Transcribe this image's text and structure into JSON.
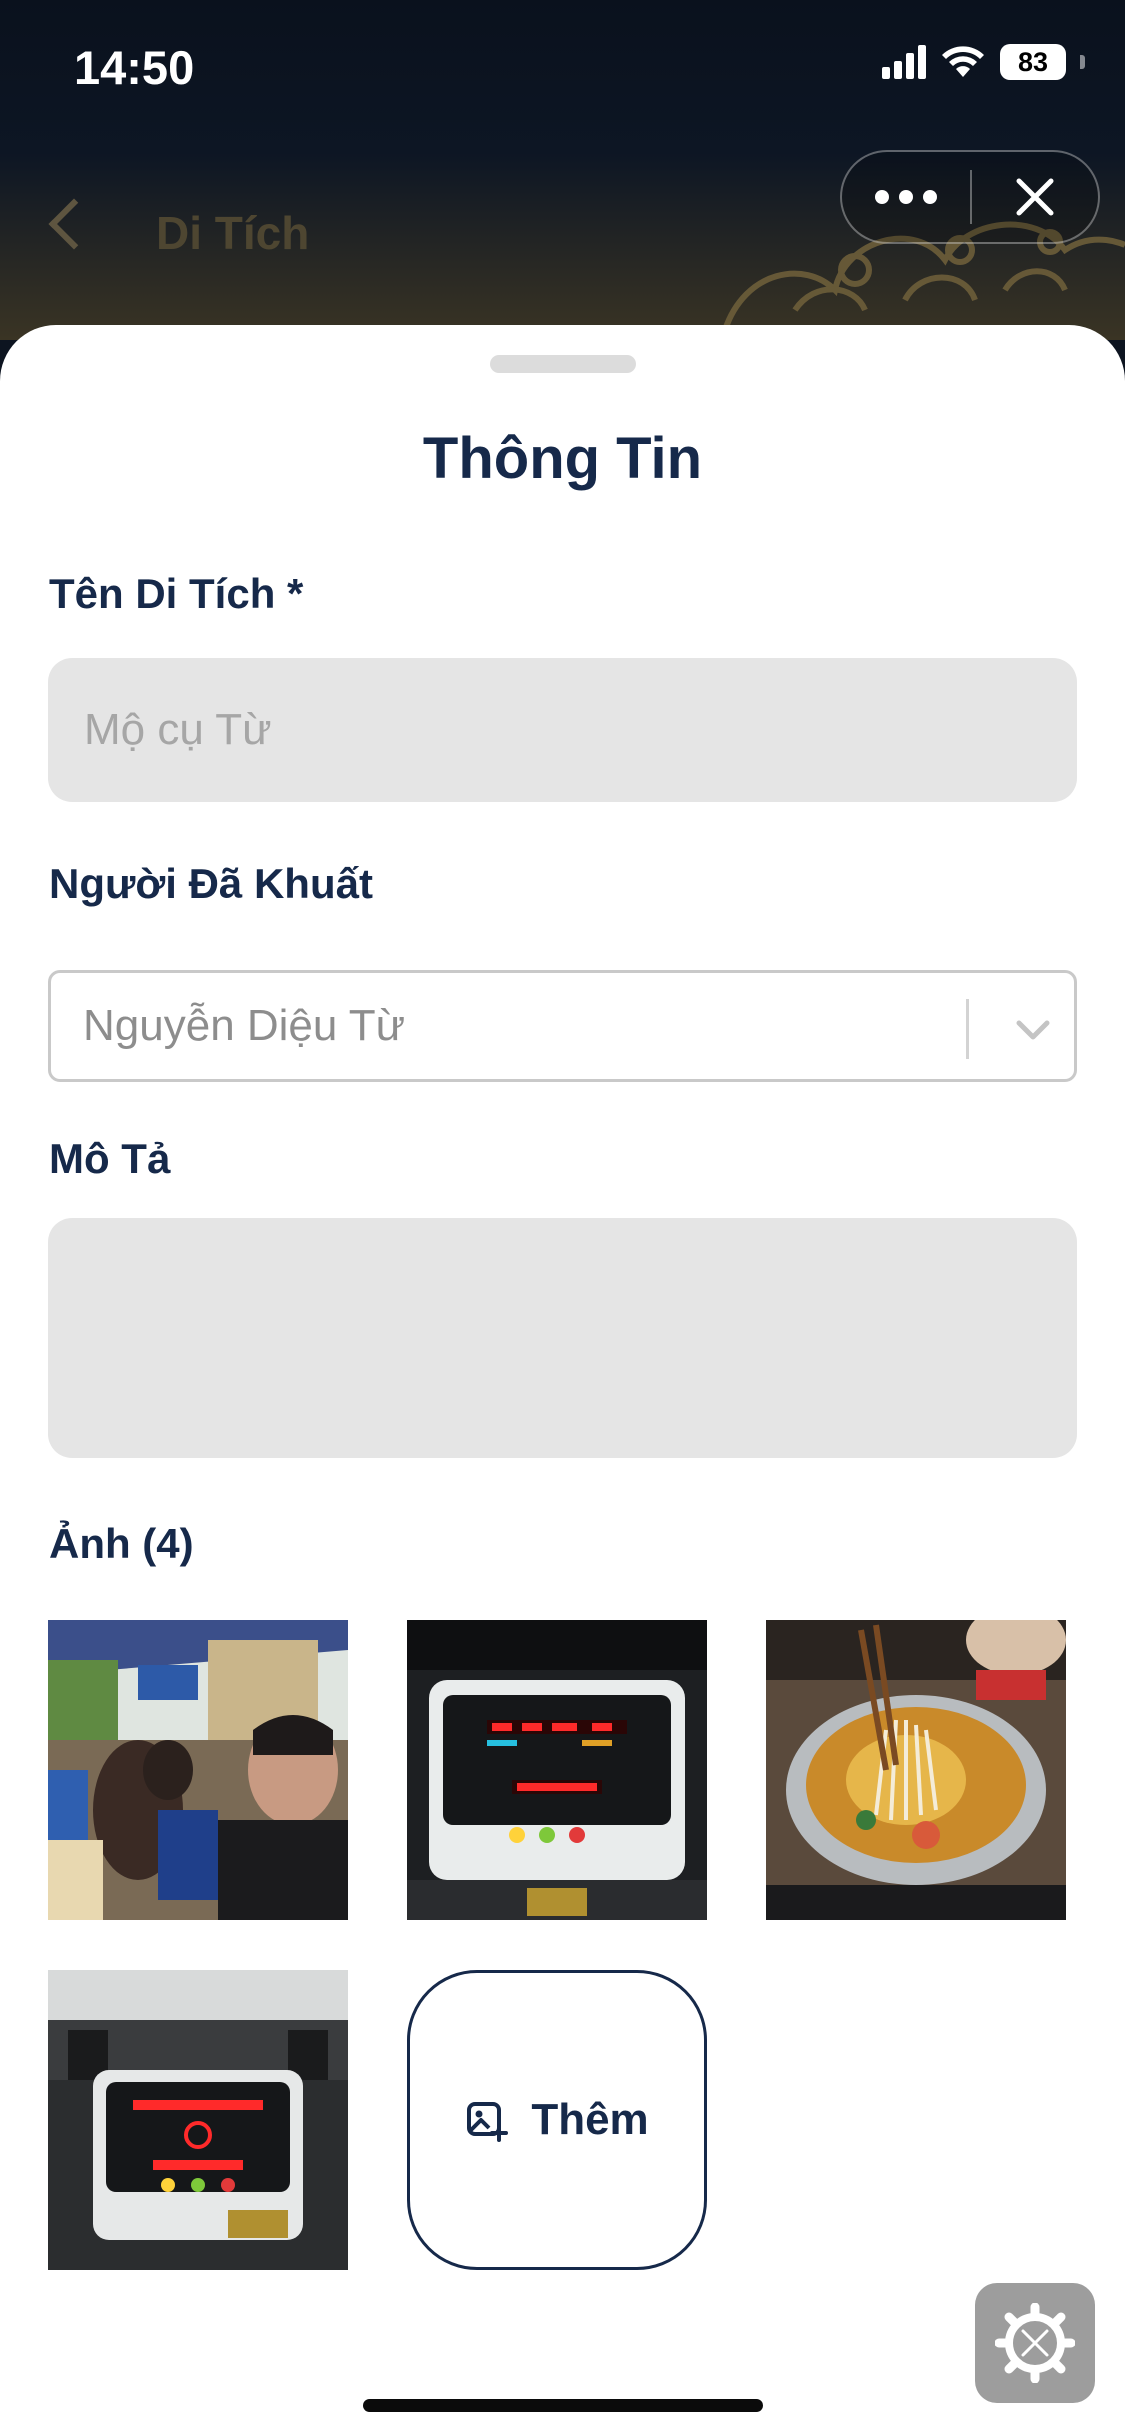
{
  "status_bar": {
    "time": "14:50",
    "battery": "83"
  },
  "header": {
    "title": "Di Tích"
  },
  "capsule": {
    "more_icon": "more-dots-icon",
    "close_icon": "close-icon"
  },
  "sheet": {
    "title": "Thông Tin",
    "name_field": {
      "label": "Tên Di Tích *",
      "placeholder": "Mộ cụ Từ"
    },
    "deceased_field": {
      "label": "Người Đã Khuất",
      "value": "Nguyễn Diệu Từ"
    },
    "description_field": {
      "label": "Mô Tả",
      "value": ""
    },
    "photos": {
      "label": "Ảnh (4)",
      "items": [
        "street-cafe-photo",
        "treadmill-console-photo",
        "hotpot-photo",
        "gym-treadmill-photo"
      ],
      "add_label": "Thêm"
    }
  },
  "colors": {
    "primary": "#16294a",
    "input_fill": "#e5e5e5",
    "placeholder": "#a6a6a6",
    "header_bg": "#0d1420",
    "header_accent": "#6d5e3a"
  }
}
